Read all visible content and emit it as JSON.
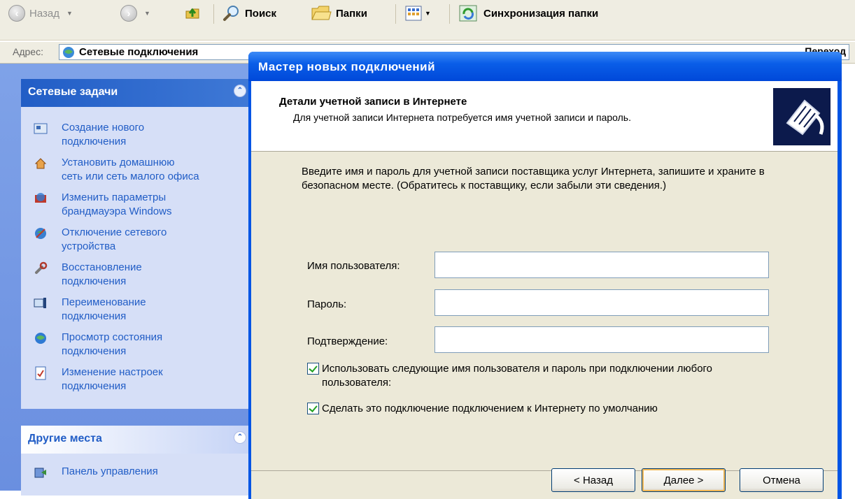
{
  "toolbar": {
    "back_label": "Назад",
    "search_label": "Поиск",
    "folders_label": "Папки",
    "sync_label": "Синхронизация папки"
  },
  "address": {
    "label": "Адрес:",
    "value": "Сетевые подключения",
    "go_label": "Переход"
  },
  "tasks_panel": {
    "title": "Сетевые задачи",
    "items": [
      {
        "label": "Создание нового\nподключения",
        "icon": "new-connection-icon"
      },
      {
        "label": "Установить домашнюю\nсеть или сеть малого офиса",
        "icon": "home-network-icon"
      },
      {
        "label": "Изменить параметры\nбрандмауэра Windows",
        "icon": "firewall-icon"
      },
      {
        "label": "Отключение сетевого\nустройства",
        "icon": "disable-device-icon"
      },
      {
        "label": "Восстановление\nподключения",
        "icon": "repair-icon"
      },
      {
        "label": "Переименование\nподключения",
        "icon": "rename-icon"
      },
      {
        "label": "Просмотр состояния\nподключения",
        "icon": "status-icon"
      },
      {
        "label": "Изменение настроек\nподключения",
        "icon": "settings-icon"
      }
    ]
  },
  "other_places": {
    "title": "Другие места",
    "items": [
      {
        "label": "Панель управления",
        "icon": "control-panel-icon"
      }
    ]
  },
  "wizard": {
    "title": "Мастер новых подключений",
    "header_title": "Детали учетной записи в Интернете",
    "header_subtitle": "Для учетной записи Интернета потребуется имя учетной записи и пароль.",
    "instructions": "Введите имя и пароль для учетной записи поставщика услуг Интернета, запишите и храните в безопасном месте. (Обратитесь к поставщику, если забыли эти сведения.)",
    "fields": {
      "username_label": "Имя пользователя:",
      "username_value": "",
      "password_label": "Пароль:",
      "password_value": "",
      "confirm_label": "Подтверждение:",
      "confirm_value": ""
    },
    "checkboxes": {
      "all_users_label": "Использовать следующие имя пользователя и пароль при подключении любого пользователя:",
      "all_users_checked": true,
      "default_label": "Сделать это подключение подключением к Интернету по умолчанию",
      "default_checked": true
    },
    "buttons": {
      "back": "< Назад",
      "next": "Далее >",
      "cancel": "Отмена"
    }
  }
}
